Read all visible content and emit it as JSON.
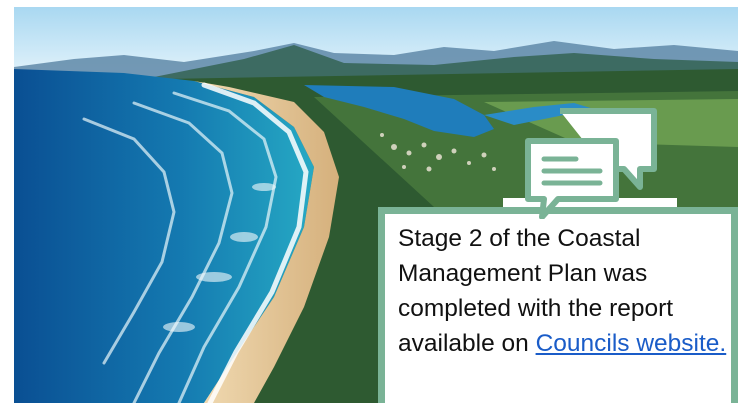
{
  "hero": {
    "image_description_icon": "aerial-coastline-photo",
    "colors": {
      "sky": "#bfe2f4",
      "ocean_deep": "#0c5a9c",
      "ocean_shallow": "#22a3c2",
      "sand": "#e7c99a",
      "forest": "#2e5a31",
      "accent_green": "#7ab396"
    }
  },
  "callout": {
    "icon": "speech-bubbles-icon",
    "text_before_link": "Stage 2 of the Coastal Management Plan was completed with the report available on ",
    "link_label": "Councils website."
  }
}
